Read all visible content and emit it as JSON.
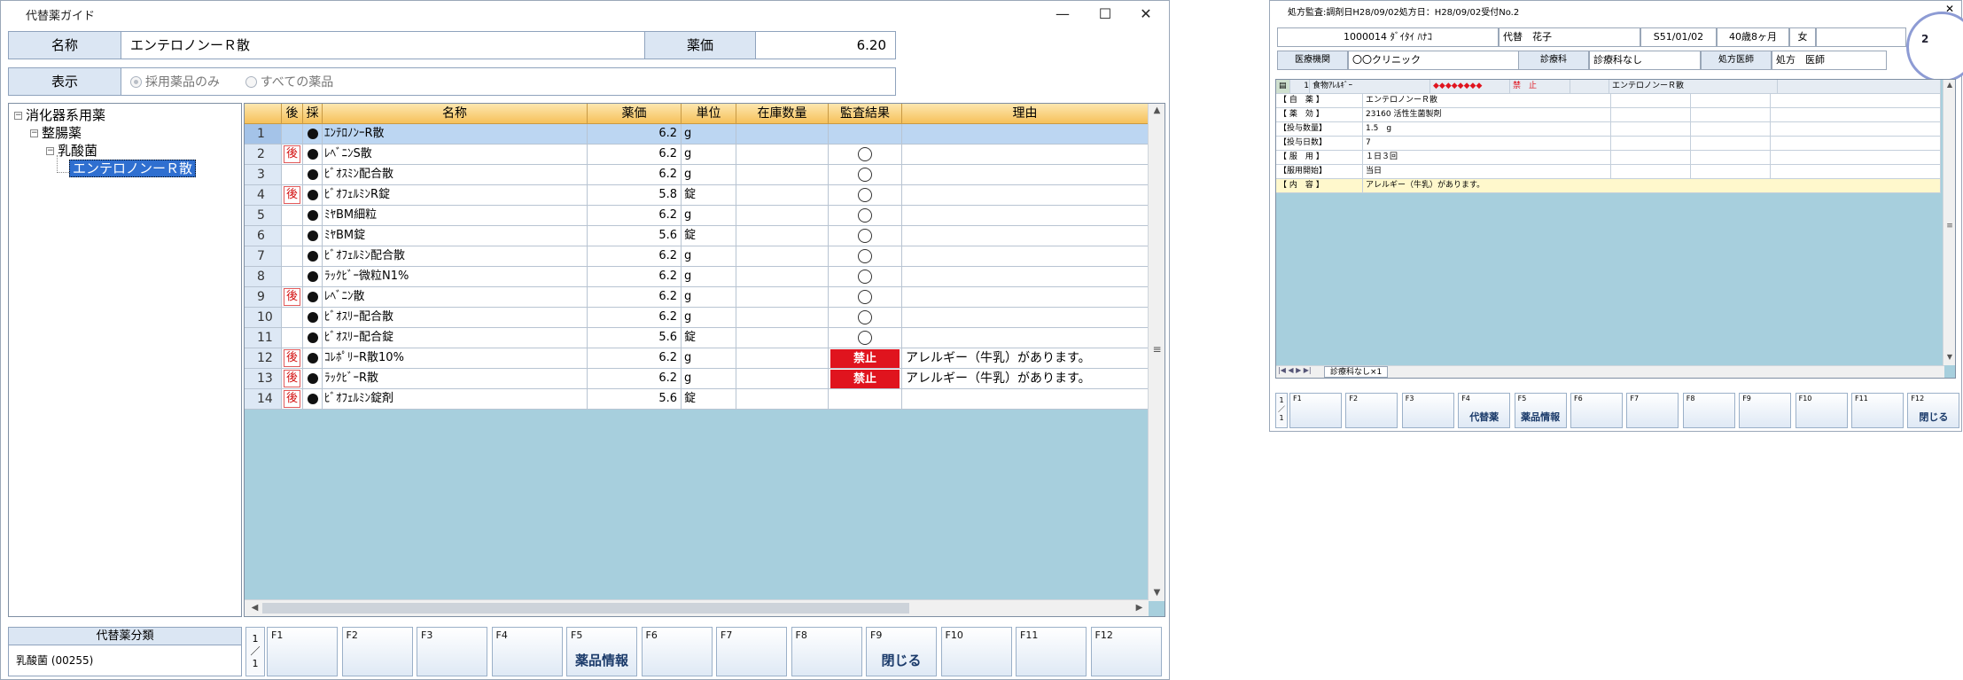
{
  "window": {
    "title": "代替薬ガイド",
    "controls": {
      "minimize": "—",
      "maximize": "☐",
      "close": "✕"
    }
  },
  "info": {
    "name_label": "名称",
    "name_value": "エンテロノンーＲ散",
    "price_label": "薬価",
    "price_value": "6.20",
    "display_label": "表示",
    "option_adopted": "採用薬品のみ",
    "option_all": "すべての薬品",
    "selected_option": "採用薬品のみ"
  },
  "tree": {
    "root": "消化器系用薬",
    "child": "整腸薬",
    "grandchild": "乳酸菌",
    "selected_leaf": "エンテロノンーＲ散"
  },
  "grid": {
    "headers": {
      "after": "後",
      "adopted": "採",
      "name": "名称",
      "price": "薬価",
      "unit": "単位",
      "stock": "在庫数量",
      "audit": "監査結果",
      "reason": "理由"
    },
    "rows": [
      {
        "no": "1",
        "after": "",
        "adopted": "●",
        "name": "ｴﾝﾃﾛﾉﾝｰR散",
        "price": "6.2",
        "unit": "g",
        "audit": "",
        "reason": ""
      },
      {
        "no": "2",
        "after": "後",
        "adopted": "●",
        "name": "ﾚﾍﾞﾆﾝS散",
        "price": "6.2",
        "unit": "g",
        "audit": "○",
        "reason": ""
      },
      {
        "no": "3",
        "after": "",
        "adopted": "●",
        "name": "ﾋﾞｵｽﾐﾝ配合散",
        "price": "6.2",
        "unit": "g",
        "audit": "○",
        "reason": ""
      },
      {
        "no": "4",
        "after": "後",
        "adopted": "●",
        "name": "ﾋﾞｵﾌｪﾙﾐﾝR錠",
        "price": "5.8",
        "unit": "錠",
        "audit": "○",
        "reason": ""
      },
      {
        "no": "5",
        "after": "",
        "adopted": "●",
        "name": "ﾐﾔBM細粒",
        "price": "6.2",
        "unit": "g",
        "audit": "○",
        "reason": ""
      },
      {
        "no": "6",
        "after": "",
        "adopted": "●",
        "name": "ﾐﾔBM錠",
        "price": "5.6",
        "unit": "錠",
        "audit": "○",
        "reason": ""
      },
      {
        "no": "7",
        "after": "",
        "adopted": "●",
        "name": "ﾋﾞｵﾌｪﾙﾐﾝ配合散",
        "price": "6.2",
        "unit": "g",
        "audit": "○",
        "reason": ""
      },
      {
        "no": "8",
        "after": "",
        "adopted": "●",
        "name": "ﾗｯｸﾋﾞｰ微粒N1%",
        "price": "6.2",
        "unit": "g",
        "audit": "○",
        "reason": ""
      },
      {
        "no": "9",
        "after": "後",
        "adopted": "●",
        "name": "ﾚﾍﾞﾆﾝ散",
        "price": "6.2",
        "unit": "g",
        "audit": "○",
        "reason": ""
      },
      {
        "no": "10",
        "after": "",
        "adopted": "●",
        "name": "ﾋﾞｵｽﾘｰ配合散",
        "price": "6.2",
        "unit": "g",
        "audit": "○",
        "reason": ""
      },
      {
        "no": "11",
        "after": "",
        "adopted": "●",
        "name": "ﾋﾞｵｽﾘｰ配合錠",
        "price": "5.6",
        "unit": "錠",
        "audit": "○",
        "reason": ""
      },
      {
        "no": "12",
        "after": "後",
        "adopted": "●",
        "name": "ｺﾚﾎﾟﾘｰR散10%",
        "price": "6.2",
        "unit": "g",
        "audit": "禁止",
        "reason": "アレルギー（牛乳）があります。"
      },
      {
        "no": "13",
        "after": "後",
        "adopted": "●",
        "name": "ﾗｯｸﾋﾞｰR散",
        "price": "6.2",
        "unit": "g",
        "audit": "禁止",
        "reason": "アレルギー（牛乳）があります。"
      },
      {
        "no": "14",
        "after": "後",
        "adopted": "●",
        "name": "ﾋﾞｵﾌｪﾙﾐﾝ錠剤",
        "price": "5.6",
        "unit": "錠",
        "audit": "",
        "reason": ""
      }
    ]
  },
  "classification": {
    "title": "代替薬分類",
    "value": "乳酸菌 (00255)"
  },
  "pager": {
    "text1": "1",
    "text2": "／",
    "text3": "1"
  },
  "fkeys": [
    {
      "fn": "F1",
      "label": ""
    },
    {
      "fn": "F2",
      "label": ""
    },
    {
      "fn": "F3",
      "label": ""
    },
    {
      "fn": "F4",
      "label": ""
    },
    {
      "fn": "F5",
      "label": "薬品情報"
    },
    {
      "fn": "F6",
      "label": ""
    },
    {
      "fn": "F7",
      "label": ""
    },
    {
      "fn": "F8",
      "label": ""
    },
    {
      "fn": "F9",
      "label": "閉じる"
    },
    {
      "fn": "F10",
      "label": ""
    },
    {
      "fn": "F11",
      "label": ""
    },
    {
      "fn": "F12",
      "label": ""
    }
  ],
  "window2": {
    "title": "処方監査:調剤日H28/09/02処方日：H28/09/02受付No.2",
    "close": "✕",
    "badge": "2",
    "patient_id_name": "1000014 ﾀﾞｲﾀｲ ﾊﾅｺ",
    "patient_name": "代替　花子",
    "birth": "S51/01/02",
    "age": "40歳8ヶ月",
    "sex": "女",
    "inst_label": "医療機関",
    "inst_value": "〇〇クリニック",
    "dept_label": "診療科",
    "dept_value": "診療科なし",
    "doctor_label": "処方医師",
    "doctor_value": "処方　医師",
    "grid_header": {
      "no": "1",
      "allergy": "食物ｱﾚﾙｷﾞｰ",
      "mark": "◆◆◆◆◆◆◆◆",
      "status": "禁　止",
      "drug": "エンテロノンーＲ散"
    },
    "detail_rows": [
      {
        "label": "【 自　薬 】",
        "value": "エンテロノンーＲ散"
      },
      {
        "label": "【 薬　効 】",
        "value": "23160 活性生菌製剤"
      },
      {
        "label": "【投与数量】",
        "value": "1.5　g"
      },
      {
        "label": "【投与日数】",
        "value": "7"
      },
      {
        "label": "【 服　用 】",
        "value": "１日３回"
      },
      {
        "label": "【服用開始】",
        "value": "当日"
      },
      {
        "label": "【 内　容 】",
        "value": "アレルギー（牛乳）があります。"
      }
    ],
    "tab": "診療科なし×1",
    "pager": "1／1",
    "fkeys": [
      {
        "fn": "F1",
        "label": ""
      },
      {
        "fn": "F2",
        "label": ""
      },
      {
        "fn": "F3",
        "label": ""
      },
      {
        "fn": "F4",
        "label": "代替薬"
      },
      {
        "fn": "F5",
        "label": "薬品情報"
      },
      {
        "fn": "F6",
        "label": ""
      },
      {
        "fn": "F7",
        "label": ""
      },
      {
        "fn": "F8",
        "label": ""
      },
      {
        "fn": "F9",
        "label": ""
      },
      {
        "fn": "F10",
        "label": ""
      },
      {
        "fn": "F11",
        "label": ""
      },
      {
        "fn": "F12",
        "label": "閉じる"
      }
    ]
  },
  "colors": {
    "accent": "#2f6fd0",
    "ban": "#e0141e",
    "grid_bg": "#a7cfdd",
    "header": "#f6c15a"
  }
}
